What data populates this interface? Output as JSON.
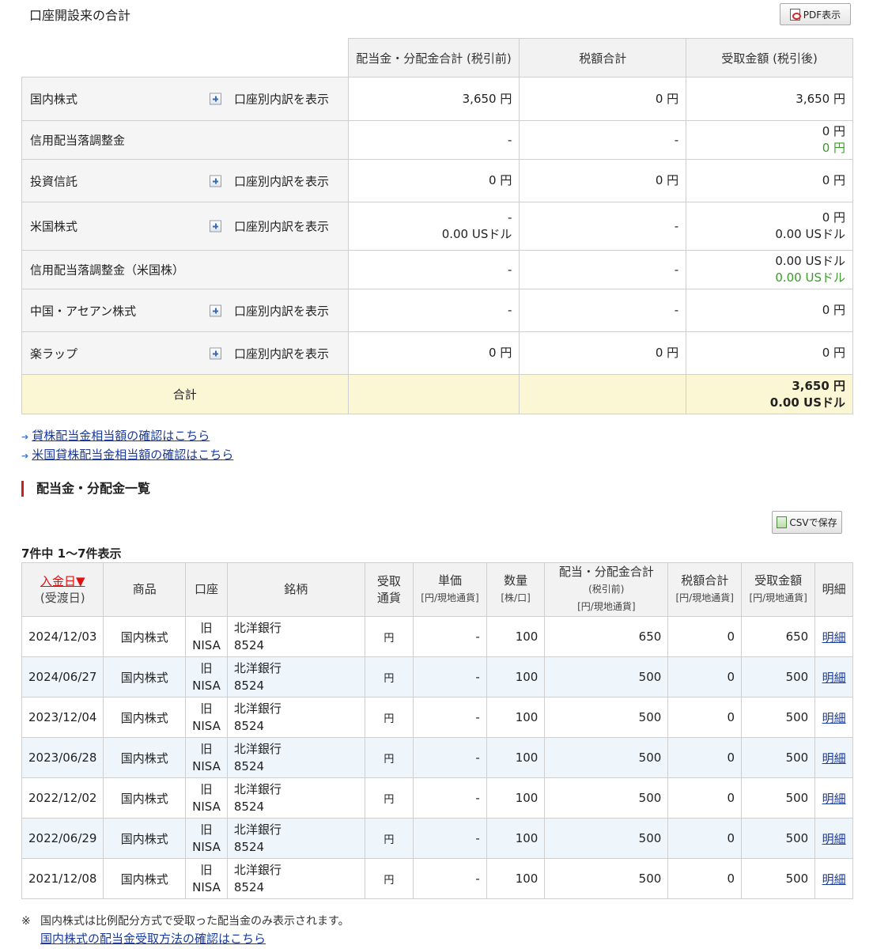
{
  "page": {
    "title": "口座開設来の合計",
    "pdf_label": "PDF表示"
  },
  "summary": {
    "headers": [
      "配当金・分配金合計 (税引前)",
      "税額合計",
      "受取金額 (税引後)"
    ],
    "expand_label": "口座別内訳を表示",
    "rows": [
      {
        "name": "国内株式",
        "expand": true,
        "pre": [
          "3,650 円"
        ],
        "tax": [
          "0 円"
        ],
        "net": [
          "3,650 円"
        ]
      },
      {
        "name": "信用配当落調整金",
        "expand": false,
        "pre": [
          "-"
        ],
        "tax": [
          "-"
        ],
        "net": [
          "0 円"
        ],
        "net_green": "0 円"
      },
      {
        "name": "投資信託",
        "expand": true,
        "pre": [
          "0 円"
        ],
        "tax": [
          "0 円"
        ],
        "net": [
          "0 円"
        ]
      },
      {
        "name": "米国株式",
        "expand": true,
        "pre": [
          "-",
          "0.00 USドル"
        ],
        "tax": [
          "-"
        ],
        "net": [
          "0 円",
          "0.00 USドル"
        ]
      },
      {
        "name": "信用配当落調整金（米国株）",
        "expand": false,
        "pre": [
          "-"
        ],
        "tax": [
          "-"
        ],
        "net": [
          "0.00 USドル"
        ],
        "net_green": "0.00 USドル"
      },
      {
        "name": "中国・アセアン株式",
        "expand": true,
        "pre": [
          "-"
        ],
        "tax": [
          "-"
        ],
        "net": [
          "0 円"
        ]
      },
      {
        "name": "楽ラップ",
        "expand": true,
        "pre": [
          "0 円"
        ],
        "tax": [
          "0 円"
        ],
        "net": [
          "0 円"
        ]
      }
    ],
    "total": {
      "label": "合計",
      "net": [
        "3,650 円",
        "0.00 USドル"
      ]
    }
  },
  "links": [
    "貸株配当金相当額の確認はこちら",
    "米国貸株配当金相当額の確認はこちら"
  ],
  "section": {
    "title": "配当金・分配金一覧",
    "csv_label": "CSVで保存",
    "count": "7件中 1〜7件表示"
  },
  "list": {
    "headers": {
      "date": "入金日▼",
      "date_sub": "(受渡日)",
      "product": "商品",
      "account": "口座",
      "name": "銘柄",
      "currency": [
        "受取",
        "通貨"
      ],
      "unit": "単価",
      "unit_sub": "[円/現地通貨]",
      "qty": "数量",
      "qty_sub": "[株/口]",
      "gross": "配当・分配金合計",
      "gross_sub1": "(税引前)",
      "gross_sub2": "[円/現地通貨]",
      "tax": "税額合計",
      "tax_sub": "[円/現地通貨]",
      "net": "受取金額",
      "net_sub": "[円/現地通貨]",
      "detail": "明細"
    },
    "rows": [
      {
        "date": "2024/12/03",
        "product": "国内株式",
        "acct1": "旧",
        "acct2": "NISA",
        "name1": "北洋銀行",
        "name2": "8524",
        "cur": "円",
        "unit": "-",
        "qty": "100",
        "gross": "650",
        "tax": "0",
        "net": "650",
        "detail": "明細"
      },
      {
        "date": "2024/06/27",
        "product": "国内株式",
        "acct1": "旧",
        "acct2": "NISA",
        "name1": "北洋銀行",
        "name2": "8524",
        "cur": "円",
        "unit": "-",
        "qty": "100",
        "gross": "500",
        "tax": "0",
        "net": "500",
        "detail": "明細"
      },
      {
        "date": "2023/12/04",
        "product": "国内株式",
        "acct1": "旧",
        "acct2": "NISA",
        "name1": "北洋銀行",
        "name2": "8524",
        "cur": "円",
        "unit": "-",
        "qty": "100",
        "gross": "500",
        "tax": "0",
        "net": "500",
        "detail": "明細"
      },
      {
        "date": "2023/06/28",
        "product": "国内株式",
        "acct1": "旧",
        "acct2": "NISA",
        "name1": "北洋銀行",
        "name2": "8524",
        "cur": "円",
        "unit": "-",
        "qty": "100",
        "gross": "500",
        "tax": "0",
        "net": "500",
        "detail": "明細"
      },
      {
        "date": "2022/12/02",
        "product": "国内株式",
        "acct1": "旧",
        "acct2": "NISA",
        "name1": "北洋銀行",
        "name2": "8524",
        "cur": "円",
        "unit": "-",
        "qty": "100",
        "gross": "500",
        "tax": "0",
        "net": "500",
        "detail": "明細"
      },
      {
        "date": "2022/06/29",
        "product": "国内株式",
        "acct1": "旧",
        "acct2": "NISA",
        "name1": "北洋銀行",
        "name2": "8524",
        "cur": "円",
        "unit": "-",
        "qty": "100",
        "gross": "500",
        "tax": "0",
        "net": "500",
        "detail": "明細"
      },
      {
        "date": "2021/12/08",
        "product": "国内株式",
        "acct1": "旧",
        "acct2": "NISA",
        "name1": "北洋銀行",
        "name2": "8524",
        "cur": "円",
        "unit": "-",
        "qty": "100",
        "gross": "500",
        "tax": "0",
        "net": "500",
        "detail": "明細"
      }
    ]
  },
  "note": {
    "mark": "※",
    "text": "国内株式は比例配分方式で受取った配当金のみ表示されます。",
    "link": "国内株式の配当金受取方法の確認はこちら"
  }
}
